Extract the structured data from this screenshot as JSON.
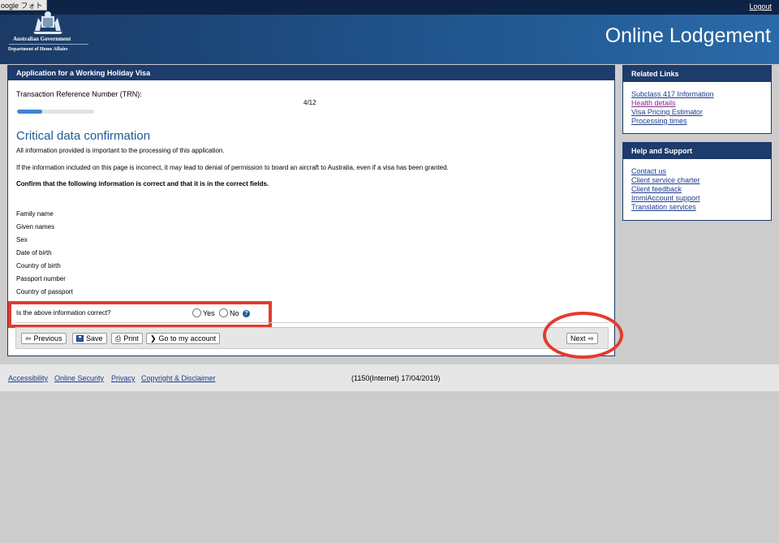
{
  "browser": {
    "label": "oogle フォト"
  },
  "header": {
    "logout": "Logout",
    "gov_line1": "Australian Government",
    "gov_line2": "Department of Home Affairs",
    "title": "Online Lodgement"
  },
  "main": {
    "section_title": "Application for a Working Holiday Visa",
    "trn_label": "Transaction Reference Number (TRN):",
    "step": "4/12",
    "progress": 0.33,
    "heading": "Critical data confirmation",
    "intro": "All information provided is important to the processing of this application.",
    "warning": "If the information included on this page is incorrect, it may lead to denial of permission to board an aircraft to Australia, even if a visa has been granted.",
    "instruction": "Confirm that the following information is correct and that it is in the correct fields.",
    "fields": [
      "Family name",
      "Given names",
      "Sex",
      "Date of birth",
      "Country of birth",
      "Passport number",
      "Country of passport"
    ],
    "question": "Is the above information correct?",
    "yes": "Yes",
    "no": "No",
    "buttons": {
      "previous": "Previous",
      "save": "Save",
      "print": "Print",
      "account": "Go to my account",
      "next": "Next"
    }
  },
  "related_links": {
    "title": "Related Links",
    "items": [
      "Subclass 417 Information",
      "Health details",
      "Visa Pricing Estimator",
      "Processing times"
    ]
  },
  "help_support": {
    "title": "Help and Support",
    "items": [
      "Contact us",
      "Client service charter",
      "Client feedback",
      "ImmiAccount support",
      "Translation services"
    ]
  },
  "footer": {
    "links": [
      "Accessibility",
      "Online Security",
      "Privacy",
      "Copyright & Disclaimer"
    ],
    "version": "(1150(Internet) 17/04/2019)"
  }
}
